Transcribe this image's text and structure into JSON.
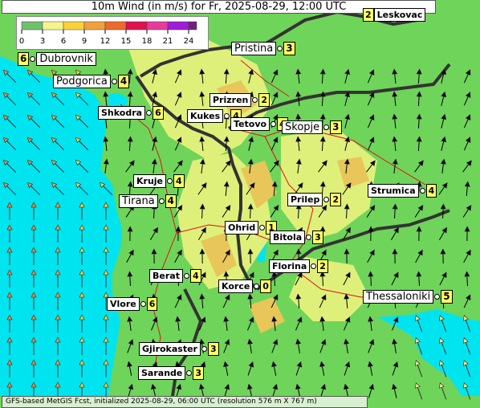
{
  "title": "10m Wind (in m/s) for Fr, 2025-08-29, 12:00 UTC",
  "legend": {
    "ticks": [
      "0",
      "3",
      "6",
      "9",
      "12",
      "15",
      "18",
      "21",
      "24"
    ],
    "colors": [
      "#6fbf6f",
      "#f4f48a",
      "#f7d23c",
      "#f2a13a",
      "#ee6a2b",
      "#e0104f",
      "#e83a9a",
      "#a01cd8",
      "#70207a"
    ]
  },
  "cities": [
    {
      "name": "Leskovac",
      "value": "2"
    },
    {
      "name": "Pristina",
      "value": "3"
    },
    {
      "name": "Dubrovnik",
      "value": "6"
    },
    {
      "name": "Podgorica",
      "value": "4"
    },
    {
      "name": "Prizren",
      "value": "2"
    },
    {
      "name": "Shkodra",
      "value": "6"
    },
    {
      "name": "Kukes",
      "value": "4"
    },
    {
      "name": "Tetovo",
      "value": "4"
    },
    {
      "name": "Skopje",
      "value": "3"
    },
    {
      "name": "Kruje",
      "value": "4"
    },
    {
      "name": "Tirana",
      "value": "4"
    },
    {
      "name": "Prilep",
      "value": "2"
    },
    {
      "name": "Strumica",
      "value": "4"
    },
    {
      "name": "Ohrid",
      "value": "1"
    },
    {
      "name": "Bitola",
      "value": "3"
    },
    {
      "name": "Florina",
      "value": "2"
    },
    {
      "name": "Berat",
      "value": "4"
    },
    {
      "name": "Korce",
      "value": "0"
    },
    {
      "name": "Thessaloniki",
      "value": "5"
    },
    {
      "name": "Vlore",
      "value": "6"
    },
    {
      "name": "Gjirokaster",
      "value": "3"
    },
    {
      "name": "Sarande",
      "value": "3"
    }
  ],
  "footer": "GFS-based MetGIS Fcst, initialized 2025-08-29, 06:00 UTC  (resolution 576 m X 767 m)",
  "colors": {
    "sea": "#00e4f0",
    "land_low": "#6fd45a",
    "land_mid": "#dff07a",
    "land_high": "#e8c65a",
    "border": "#333333",
    "road": "#e01010"
  }
}
